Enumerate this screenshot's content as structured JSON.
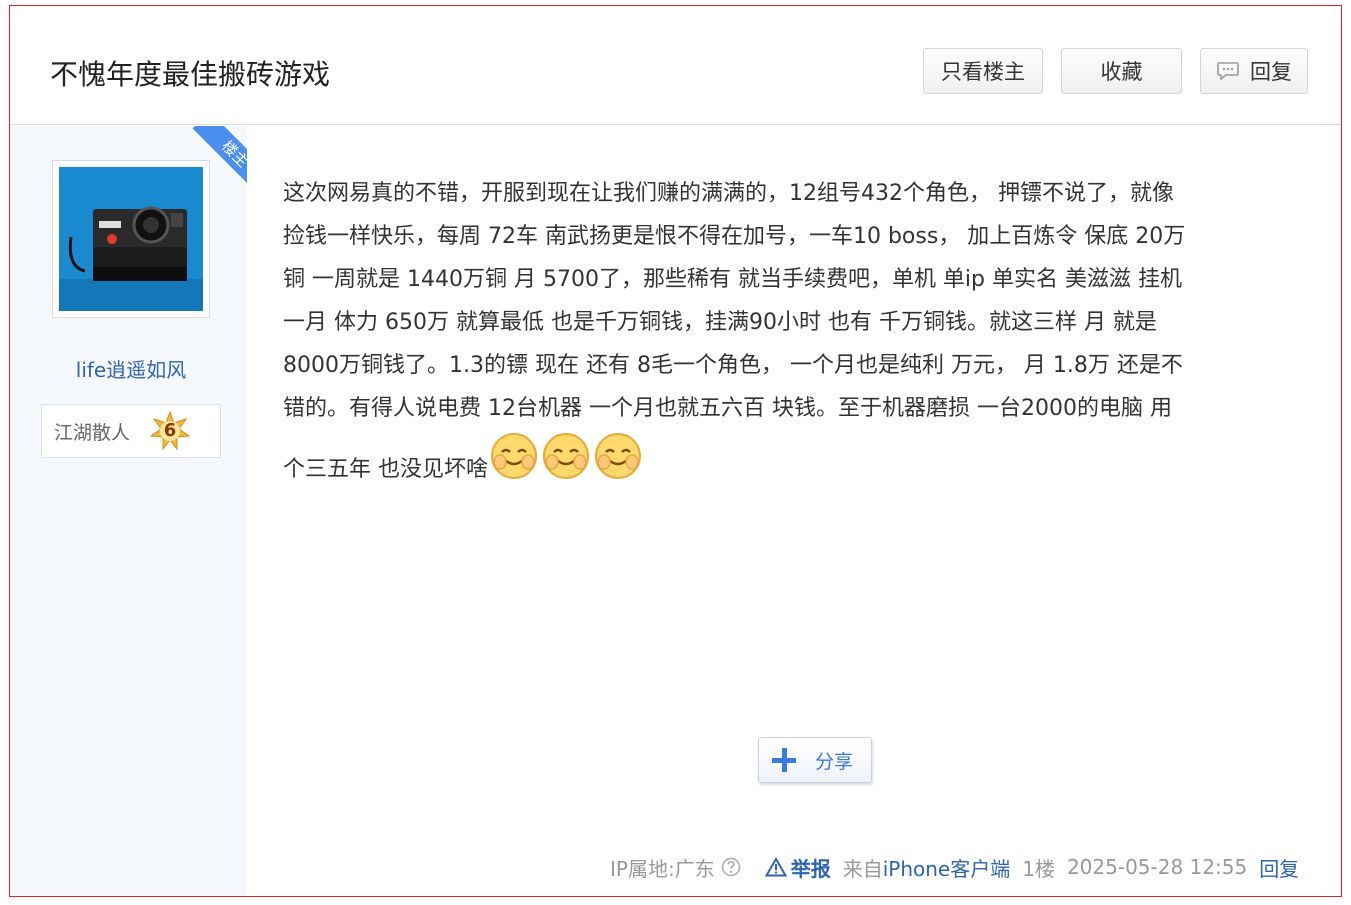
{
  "thread": {
    "title": "不愧年度最佳搬砖游戏",
    "buttons": {
      "only_op": "只看楼主",
      "favorite": "收藏",
      "reply": "回复"
    }
  },
  "post": {
    "op_badge": "楼主",
    "author": {
      "name": "life逍遥如风",
      "rank_title": "江湖散人",
      "level": "6"
    },
    "content_lines": [
      "这次网易真的不错，开服到现在让我们赚的满满的，12组号432个角色， 押镖不说了，就像",
      "捡钱一样快乐，每周 72车 南武扬更是恨不得在加号，一车10 boss， 加上百炼令 保底 20万",
      "铜 一周就是 1440万铜 月 5700了，那些稀有 就当手续费吧，单机 单ip 单实名 美滋滋 挂机",
      "一月 体力 650万 就算最低 也是千万铜钱，挂满90小时 也有 千万铜钱。就这三样 月 就是",
      "8000万铜钱了。1.3的镖 现在 还有 8毛一个角色， 一个月也是纯利 万元， 月 1.8万 还是不",
      "错的。有得人说电费 12台机器 一个月也就五六百 块钱。至于机器磨损 一台2000的电脑 用",
      "个三五年 也没见坏啥"
    ],
    "emoticons": [
      "smile-emoticon",
      "smile-emoticon",
      "smile-emoticon"
    ],
    "share_label": "分享",
    "footer": {
      "ip_location": "IP属地:广东",
      "report": "举报",
      "source": "来自",
      "client": "iPhone客户端",
      "floor": "1楼",
      "timestamp": "2025-05-28 12:55",
      "reply": "回复"
    }
  },
  "colors": {
    "link": "#2d64b3",
    "badge": "#4a8ff1",
    "sidebar_bg": "#f5f8fc",
    "border_accent": "#d8232a"
  }
}
